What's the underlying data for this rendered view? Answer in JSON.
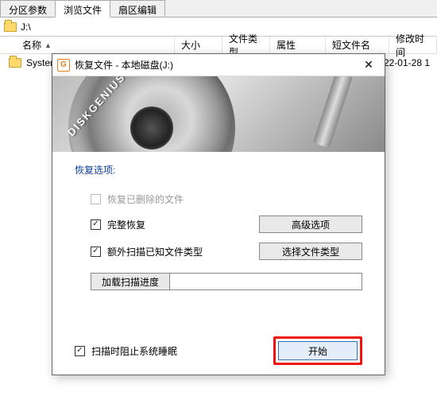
{
  "tabs": {
    "t0": "分区参数",
    "t1": "浏览文件",
    "t2": "扇区编辑"
  },
  "path": "J:\\",
  "cols": {
    "name": "名称",
    "size": "大小",
    "type": "文件类型",
    "attr": "属性",
    "short": "短文件名",
    "mod": "修改时间"
  },
  "row0": {
    "name": "System",
    "mod": "2022-01-28 1"
  },
  "dialog": {
    "title": "恢复文件 - 本地磁盘(J:)",
    "brand": "DISKGENIUS",
    "section": "恢复选项:",
    "opt_deleted": "恢复已删除的文件",
    "opt_full": "完整恢复",
    "btn_adv": "高级选项",
    "opt_extra": "额外扫描已知文件类型",
    "btn_types": "选择文件类型",
    "btn_load": "加载扫描进度",
    "opt_sleep": "扫描时阻止系统睡眠",
    "btn_start": "开始"
  }
}
